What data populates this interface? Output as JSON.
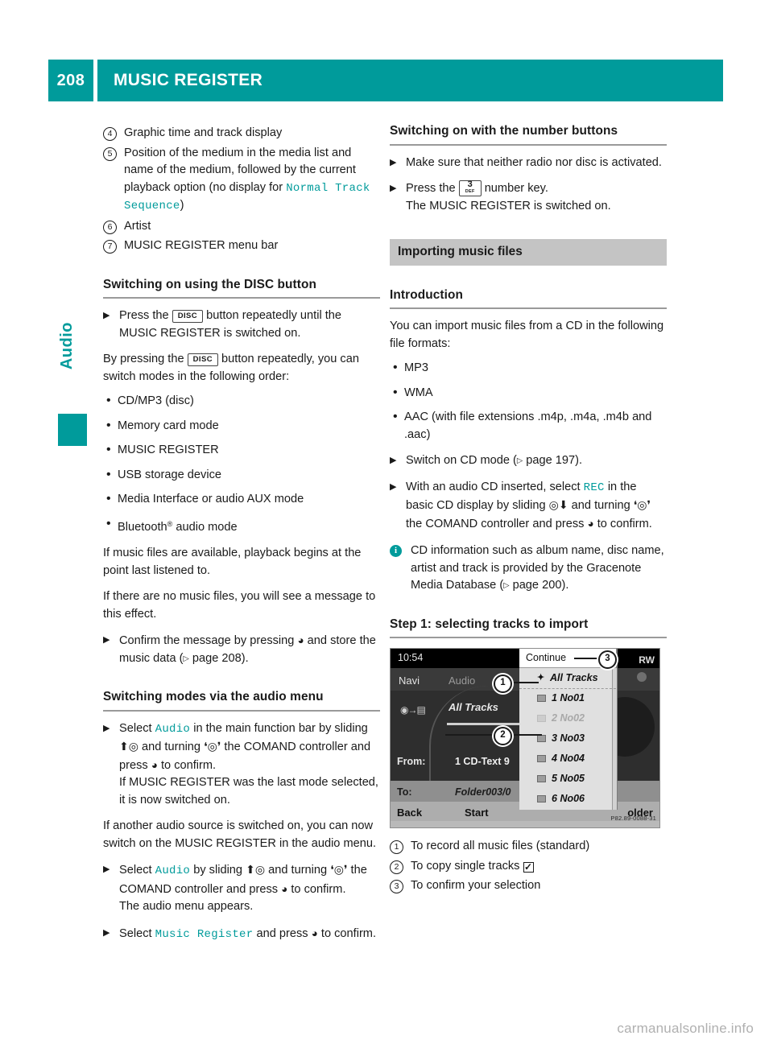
{
  "header": {
    "page_number": "208",
    "title": "MUSIC REGISTER",
    "accent_color": "#009b9b"
  },
  "side_tab": {
    "label": "Audio"
  },
  "left_column": {
    "callouts": [
      {
        "num": "4",
        "text": "Graphic time and track display"
      },
      {
        "num": "5",
        "text_a": "Position of the medium in the media list and name of the medium, followed by the current playback option (no display for ",
        "mono": "Normal Track Sequence",
        "text_b": ")"
      },
      {
        "num": "6",
        "text": "Artist"
      },
      {
        "num": "7",
        "text": "MUSIC REGISTER menu bar"
      }
    ],
    "disc_section": {
      "heading": "Switching on using the DISC button",
      "step_a": "Press the",
      "disc_key": "DISC",
      "step_b": "button repeatedly until the MUSIC REGISTER is switched on.",
      "para_a": "By pressing the",
      "para_b": "button repeatedly, you can switch modes in the following order:",
      "modes": [
        "CD/MP3 (disc)",
        "Memory card mode",
        "MUSIC REGISTER",
        "USB storage device",
        "Media Interface or audio AUX mode"
      ],
      "mode_bluetooth": "Bluetooth",
      "mode_bluetooth_suffix": " audio mode",
      "para_playback": "If music files are available, playback begins at the point last listened to.",
      "para_nofiles": "If there are no music files, you will see a message to this effect.",
      "step_confirm_a": "Confirm the message by pressing",
      "step_confirm_b": "and store the music data (",
      "step_confirm_page": "page 208",
      "step_confirm_c": ")."
    },
    "audio_menu_section": {
      "heading": "Switching modes via the audio menu",
      "step1_a": "Select",
      "step1_mono": "Audio",
      "step1_b": "in the main function bar by sliding",
      "step1_c": "and turning",
      "step1_d": "the COMAND controller and press",
      "step1_e": "to confirm.",
      "step1_note": "If MUSIC REGISTER was the last mode selected, it is now switched on.",
      "para_another": "If another audio source is switched on, you can now switch on the MUSIC REGISTER in the audio menu.",
      "step2_a": "Select",
      "step2_mono": "Audio",
      "step2_b": "by sliding",
      "step2_c": "and turning",
      "step2_d": "the COMAND controller and press",
      "step2_e": "to confirm.",
      "step2_note": "The audio menu appears.",
      "step3_a": "Select",
      "step3_mono": "Music Register",
      "step3_b": "and press",
      "step3_c": "to confirm."
    }
  },
  "right_column": {
    "number_buttons_section": {
      "heading": "Switching on with the number buttons",
      "step1": "Make sure that neither radio nor disc is activated.",
      "step2_a": "Press the",
      "key_digit": "3",
      "key_letters": "DEF",
      "step2_b": "number key.",
      "step2_note": "The MUSIC REGISTER is switched on."
    },
    "importing_section": {
      "gray_heading": "Importing music files",
      "intro_heading": "Introduction",
      "intro_text": "You can import music files from a CD in the following file formats:",
      "formats": [
        "MP3",
        "WMA",
        "AAC (with file extensions .m4p, .m4a, .m4b and .aac)"
      ],
      "step_cd_a": "Switch on CD mode (",
      "step_cd_page": "page 197",
      "step_cd_b": ").",
      "step_rec_a": "With an audio CD inserted, select",
      "step_rec_mono": "REC",
      "step_rec_b": "in the basic CD display by sliding",
      "step_rec_c": "and turning",
      "step_rec_d": "the COMAND controller and press",
      "step_rec_e": "to confirm.",
      "note_a": "CD information such as album name, disc name, artist and track is provided by the Gracenote Media Database (",
      "note_page": "page 200",
      "note_b": ")."
    },
    "step1_section": {
      "heading": "Step 1: selecting tracks to import",
      "callouts": [
        {
          "num": "1",
          "text": "To record all music files (standard)"
        },
        {
          "num": "2",
          "text": "To copy single tracks"
        },
        {
          "num": "3",
          "text": "To confirm your selection"
        }
      ]
    },
    "comand_screenshot": {
      "status_time": "10:54",
      "status_right": "RW",
      "menu_navi": "Navi",
      "menu_audio": "Audio",
      "main_title": "All Tracks",
      "from_label": "From:",
      "from_value": "1 CD-Text 9",
      "to_label": "To:",
      "to_value": "Folder003/0",
      "button_back": "Back",
      "button_start": "Start",
      "button_folder": "older",
      "continue_label": "Continue",
      "tracks": [
        {
          "num": "",
          "name": "All Tracks",
          "dim": false,
          "head": true
        },
        {
          "num": "1",
          "name": "No01",
          "dim": false,
          "head": false
        },
        {
          "num": "2",
          "name": "No02",
          "dim": true,
          "head": false
        },
        {
          "num": "3",
          "name": "No03",
          "dim": false,
          "head": false
        },
        {
          "num": "4",
          "name": "No04",
          "dim": false,
          "head": false
        },
        {
          "num": "5",
          "name": "No05",
          "dim": false,
          "head": false
        },
        {
          "num": "6",
          "name": "No06",
          "dim": false,
          "head": false
        }
      ],
      "marker_1": "1",
      "marker_2": "2",
      "marker_3": "3",
      "image_code": "P82.89-0088-31"
    }
  },
  "footer": {
    "watermark": "carmanualsonline.info"
  }
}
